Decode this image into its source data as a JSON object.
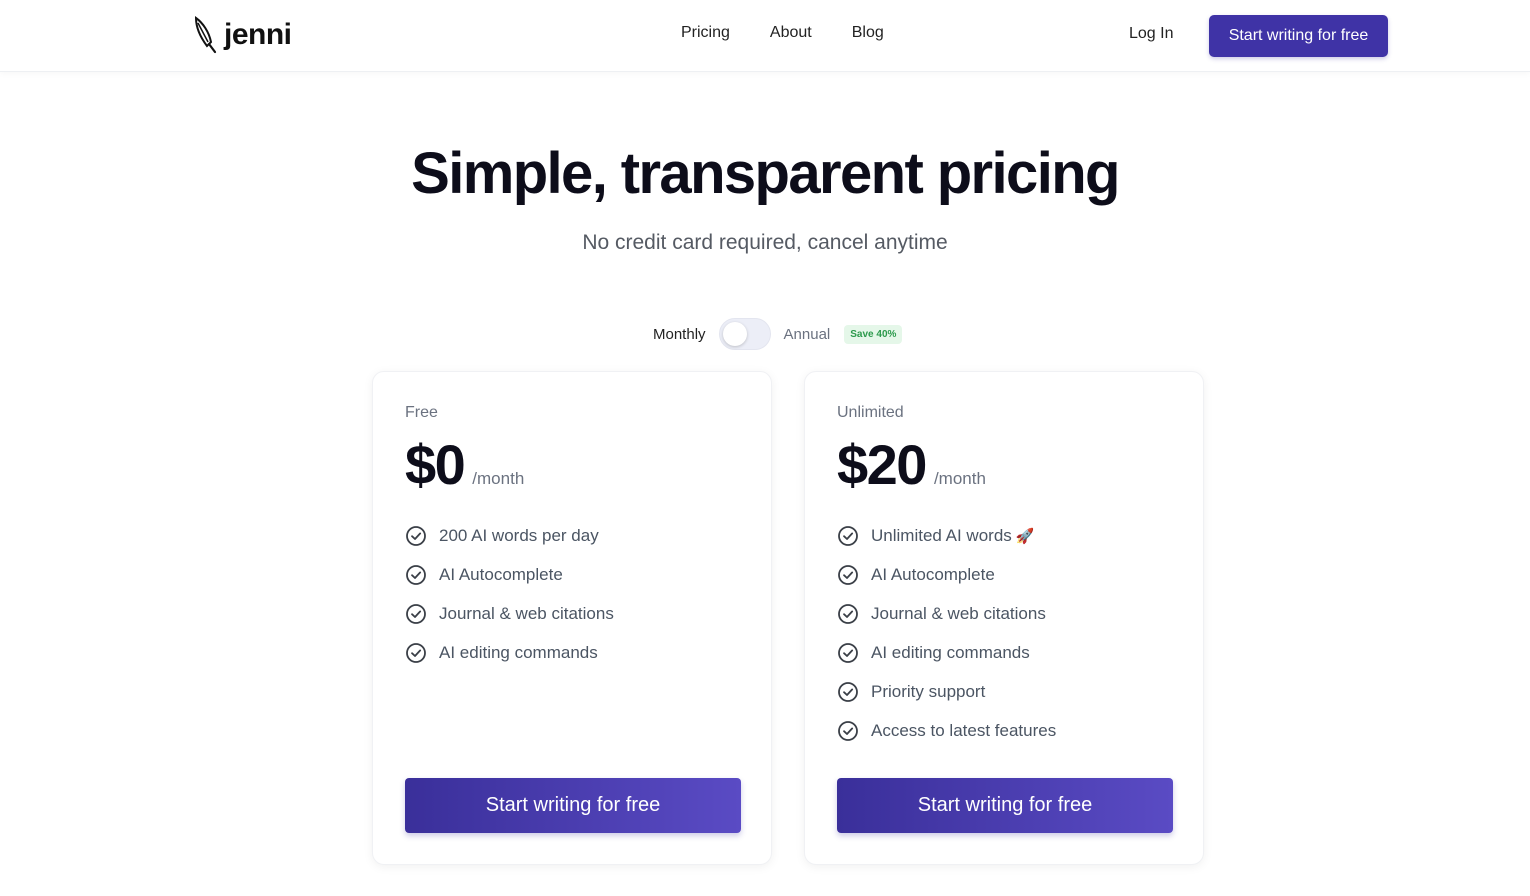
{
  "header": {
    "logo_text": "jenni",
    "logo_icon": "feather-pen-icon",
    "nav": [
      "Pricing",
      "About",
      "Blog"
    ],
    "login": "Log In",
    "cta": "Start writing for free"
  },
  "hero": {
    "title": "Simple, transparent pricing",
    "subtitle": "No credit card required, cancel anytime"
  },
  "billing": {
    "monthly": "Monthly",
    "annual": "Annual",
    "save": "Save 40%",
    "annual_selected": false
  },
  "plans": [
    {
      "name": "Free",
      "price": "$0",
      "period": "/month",
      "features": [
        "200 AI words per day",
        "AI Autocomplete",
        "Journal & web citations",
        "AI editing commands"
      ],
      "cta": "Start writing for free"
    },
    {
      "name": "Unlimited",
      "price": "$20",
      "period": "/month",
      "features": [
        "Unlimited AI words",
        "AI Autocomplete",
        "Journal & web citations",
        "AI editing commands",
        "Priority support",
        "Access to latest features"
      ],
      "feature_emoji": "🚀",
      "cta": "Start writing for free"
    }
  ],
  "colors": {
    "brand": "#3f33a6",
    "save_badge": "#2c9a4c"
  }
}
